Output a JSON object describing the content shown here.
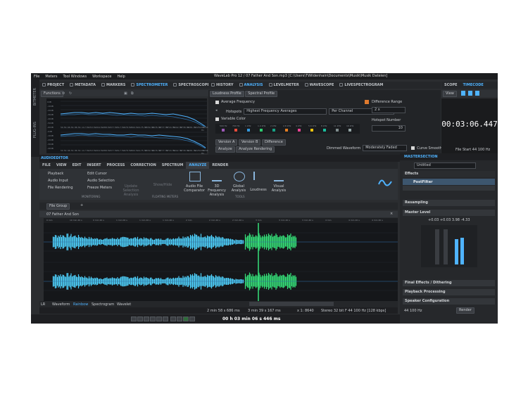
{
  "window": {
    "title": "WaveLab Pro 12 / 07 Father And Son.mp3 [C:\\Users\\TWildenhain\\Documents\\Musik\\Musik Dateien]"
  },
  "menu": [
    "File",
    "Meters",
    "Tool Windows",
    "Workspace",
    "Help"
  ],
  "left_tabs": [
    "PROJECT",
    "METADATA",
    "MARKERS",
    "SPECTROMETER",
    "SPECTROSCOPE"
  ],
  "mid_tabs": [
    "HISTORY",
    "ANALYSIS",
    "LEVELMETER",
    "WAVESCOPE",
    "LIVESPECTROGRAM"
  ],
  "right_tabs": [
    "SCOPE",
    "TIMECODE"
  ],
  "side_labels": [
    "BITMETER",
    "PLUG-INS"
  ],
  "spectrometer": {
    "functions_label": "Functions",
    "db_labels": [
      "0dB",
      "-10dB",
      "-20dB",
      "-30dB",
      "-40dB",
      "-50dB",
      "-60dB",
      "-0dB",
      "-10dB",
      "-20dB",
      "-30dB",
      "-40dB",
      "-50dB",
      "-60dB"
    ],
    "hz_labels": [
      "50 Hz",
      "66 Hz",
      "86 Hz",
      "117 Hz",
      "153 Hz",
      "204 Hz",
      "288 Hz",
      "377 Hz",
      "517 Hz",
      "678 Hz",
      "890 Hz",
      "1175 Hz",
      "1559 Hz",
      "2076 Hz",
      "2777 Hz",
      "3716 Hz",
      "5002 Hz",
      "6738 Hz",
      "9081 Hz",
      "12250 Hz",
      "17234 Hz"
    ]
  },
  "analysis": {
    "subtabs": [
      "Loudness Profile",
      "Spectral Profile"
    ],
    "average_frequency": "Average Frequency",
    "hotspots_label": "Hotspots",
    "hotspots_value": "Highest Frequency Averages",
    "channel_value": "Per Channel",
    "variable_color": "Variable Color",
    "difference_range_label": "Difference Range",
    "difference_range_value": "2 x",
    "hotspot_number_label": "Hotspot Number",
    "hotspot_number_value": "10",
    "hotspot_hz": [
      "500 Hz",
      "700 Hz",
      "1 kHz",
      "1.4 kHz",
      "2 kHz",
      "2.8 kHz",
      "4 kHz",
      "5.6 kHz",
      "8 kHz",
      "11 kHz",
      "16 kHz"
    ],
    "version_a": "Version A",
    "version_b": "Version B",
    "difference": "Difference",
    "analyze": "Analyze",
    "analyze_rendering": "Analyze Rendering",
    "dimmed_waveform_label": "Dimmed Waveform",
    "dimmed_waveform_value": "Moderately Faded",
    "curve_smoothing": "Curve Smoothing"
  },
  "timecode": {
    "view_label": "View",
    "value": "00:03:06.447",
    "footer": "File Start",
    "sample_rate": "44 100 Hz"
  },
  "audio_editor": {
    "header": "AUDIOEDITOR",
    "tabs": [
      "FILE",
      "VIEW",
      "EDIT",
      "INSERT",
      "PROCESS",
      "CORRECTION",
      "SPECTRUM",
      "ANALYZE",
      "RENDER"
    ],
    "monitoring": [
      "Playback",
      "Audio Input",
      "File Rendering",
      "Edit Cursor",
      "Audio Selection",
      "Freeze Meters"
    ],
    "group_monitoring": "MONITORING",
    "update_selection": "Update Selection Analysis",
    "show_hide": "Show/Hide",
    "group_floating": "FLOATING METERS",
    "tools": [
      "Audio File Comparator",
      "3D Frequency Analysis",
      "Global Analysis",
      "Loudness",
      "Visual Analysis"
    ],
    "group_tools": "TOOLS",
    "file_group": "File Group",
    "file_tab": "07 Father And Son",
    "ruler": [
      "0 min",
      "10 min 20 s",
      "0 min 20 s",
      "1 min 00 s",
      "1 min 20 s",
      "1 min 40 s",
      "2 min",
      "2 min 20 s",
      "2 min 40 s",
      "3 min",
      "3 min 20 s",
      "3 min 40 s",
      "4 min",
      "4 min 20 s",
      "4 min 40 s"
    ],
    "bottom_tabs": [
      "LR",
      "Waveform",
      "Rainbow",
      "Spectrogram",
      "Wavelet"
    ],
    "status": [
      "2 min 58 s 686 ms",
      "3 min 39 s 167 ms",
      "x 1: 8640",
      "Stereo 32 bit F 44 100 Hz [128 kbps]"
    ]
  },
  "transport": {
    "time": "00 h 03 min 06 s 446 ms"
  },
  "master": {
    "header": "MASTERSECTION",
    "preset": "Untitled",
    "effects_label": "Effects",
    "plugin": "PostFilter",
    "resampling": "Resampling",
    "master_level": "Master Level",
    "levels": [
      "+0.03",
      "+0.03",
      "3.98",
      "-4.33"
    ],
    "final_effects": "Final Effects / Dithering",
    "playback_processing": "Playback Processing",
    "speaker_config": "Speaker Configuration",
    "sample_rate": "44 100 Hz",
    "render": "Render"
  },
  "colors": {
    "accent": "#4fb3ff",
    "wave": "#36e07a",
    "wave2": "#4fd2ff",
    "bg": "#2b2d30"
  }
}
